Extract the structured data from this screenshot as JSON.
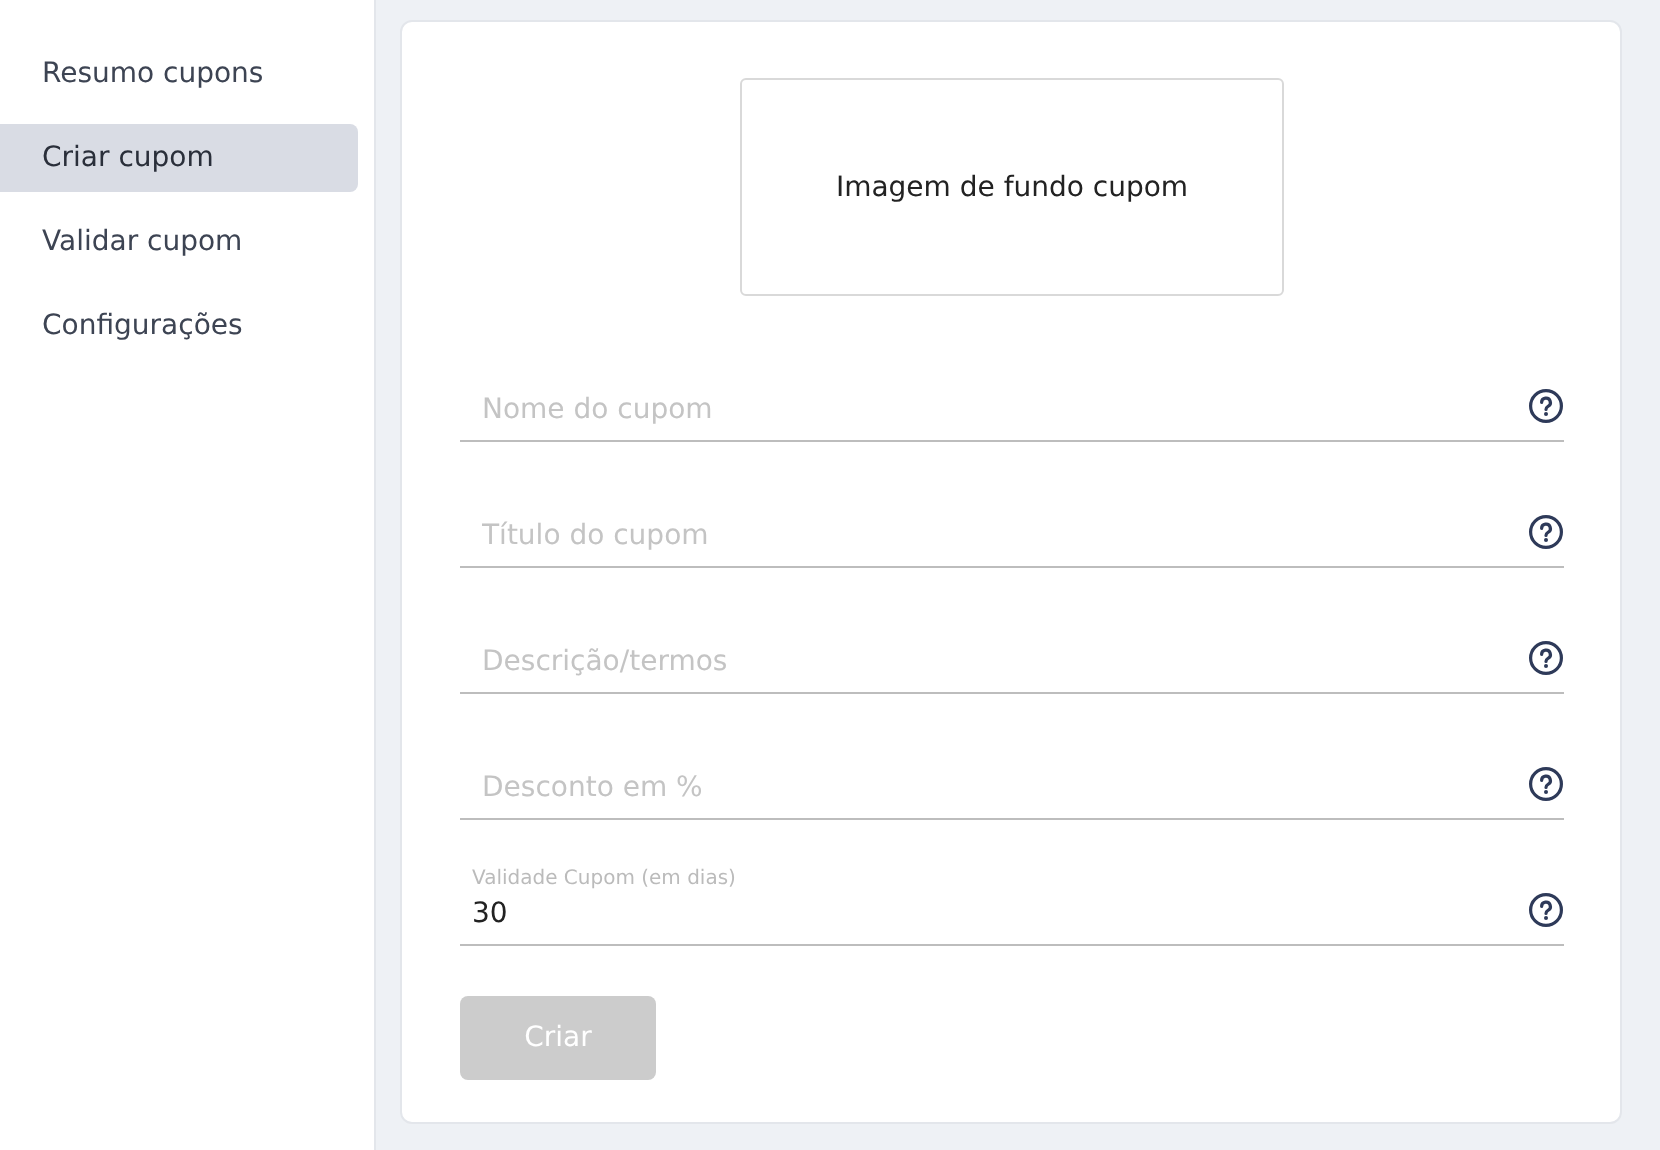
{
  "sidebar": {
    "items": [
      {
        "label": "Resumo cupons",
        "selected": false
      },
      {
        "label": "Criar cupom",
        "selected": true
      },
      {
        "label": "Validar cupom",
        "selected": false
      },
      {
        "label": "Configurações",
        "selected": false
      }
    ]
  },
  "form": {
    "image_upload": {
      "label": "Imagem de fundo cupom"
    },
    "fields": [
      {
        "kind": "placeholder",
        "placeholder": "Nome do cupom"
      },
      {
        "kind": "placeholder",
        "placeholder": "Título do cupom"
      },
      {
        "kind": "placeholder",
        "placeholder": "Descrição/termos"
      },
      {
        "kind": "placeholder",
        "placeholder": "Desconto em %"
      },
      {
        "kind": "filled",
        "label": "Validade Cupom (em dias)",
        "value": "30"
      }
    ],
    "submit": {
      "label": "Criar",
      "disabled": true
    }
  }
}
